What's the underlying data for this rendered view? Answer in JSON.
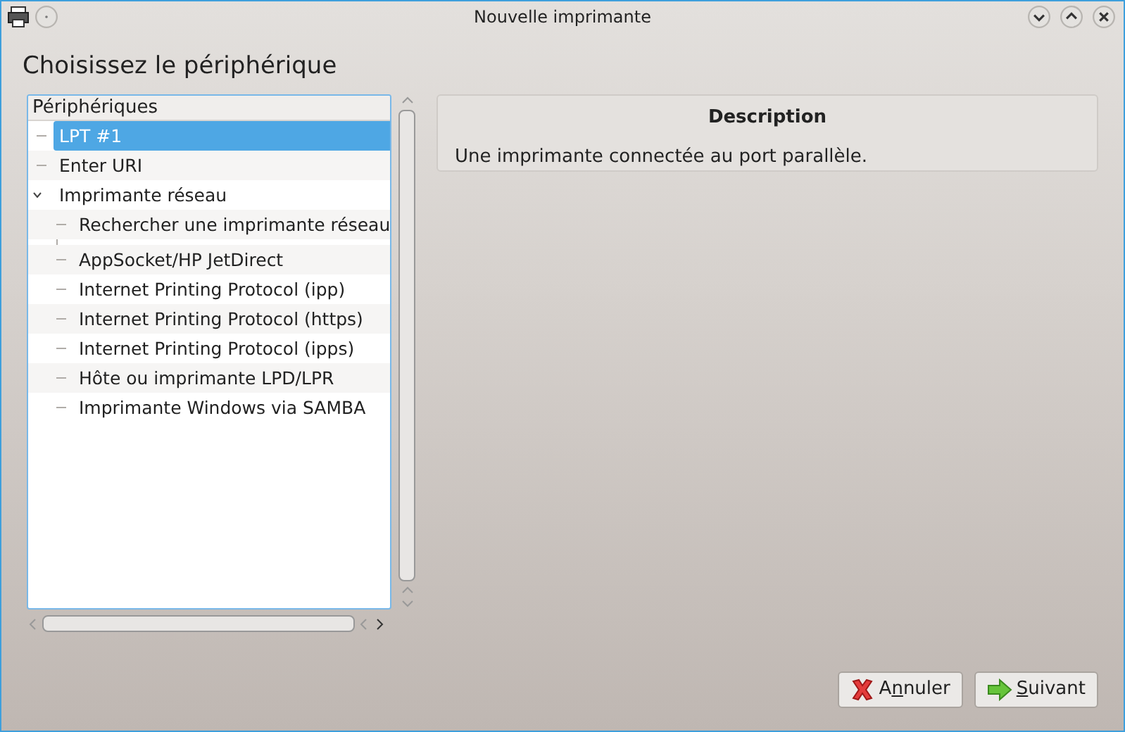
{
  "window": {
    "title": "Nouvelle imprimante"
  },
  "heading": "Choisissez le périphérique",
  "tree": {
    "header": "Périphériques",
    "items": [
      {
        "label": "LPT #1",
        "selected": true
      },
      {
        "label": "Enter URI",
        "selected": false
      },
      {
        "label": "Imprimante réseau",
        "selected": false,
        "expanded": true,
        "children": [
          {
            "label": "Rechercher une imprimante réseau",
            "selected": false
          },
          {
            "kind": "separator"
          },
          {
            "label": "AppSocket/HP JetDirect",
            "selected": false
          },
          {
            "label": "Internet Printing Protocol (ipp)",
            "selected": false
          },
          {
            "label": "Internet Printing Protocol (https)",
            "selected": false
          },
          {
            "label": "Internet Printing Protocol (ipps)",
            "selected": false
          },
          {
            "label": "Hôte ou imprimante LPD/LPR",
            "selected": false
          },
          {
            "label": "Imprimante Windows via SAMBA",
            "selected": false
          }
        ]
      }
    ]
  },
  "description": {
    "title": "Description",
    "text": "Une imprimante connectée au port parallèle."
  },
  "buttons": [
    {
      "kind": "cancel",
      "label_before": "A",
      "mnemonic": "n",
      "label_after": "nuler"
    },
    {
      "kind": "next",
      "mnemonic": "S",
      "label_after": "uivant"
    }
  ]
}
